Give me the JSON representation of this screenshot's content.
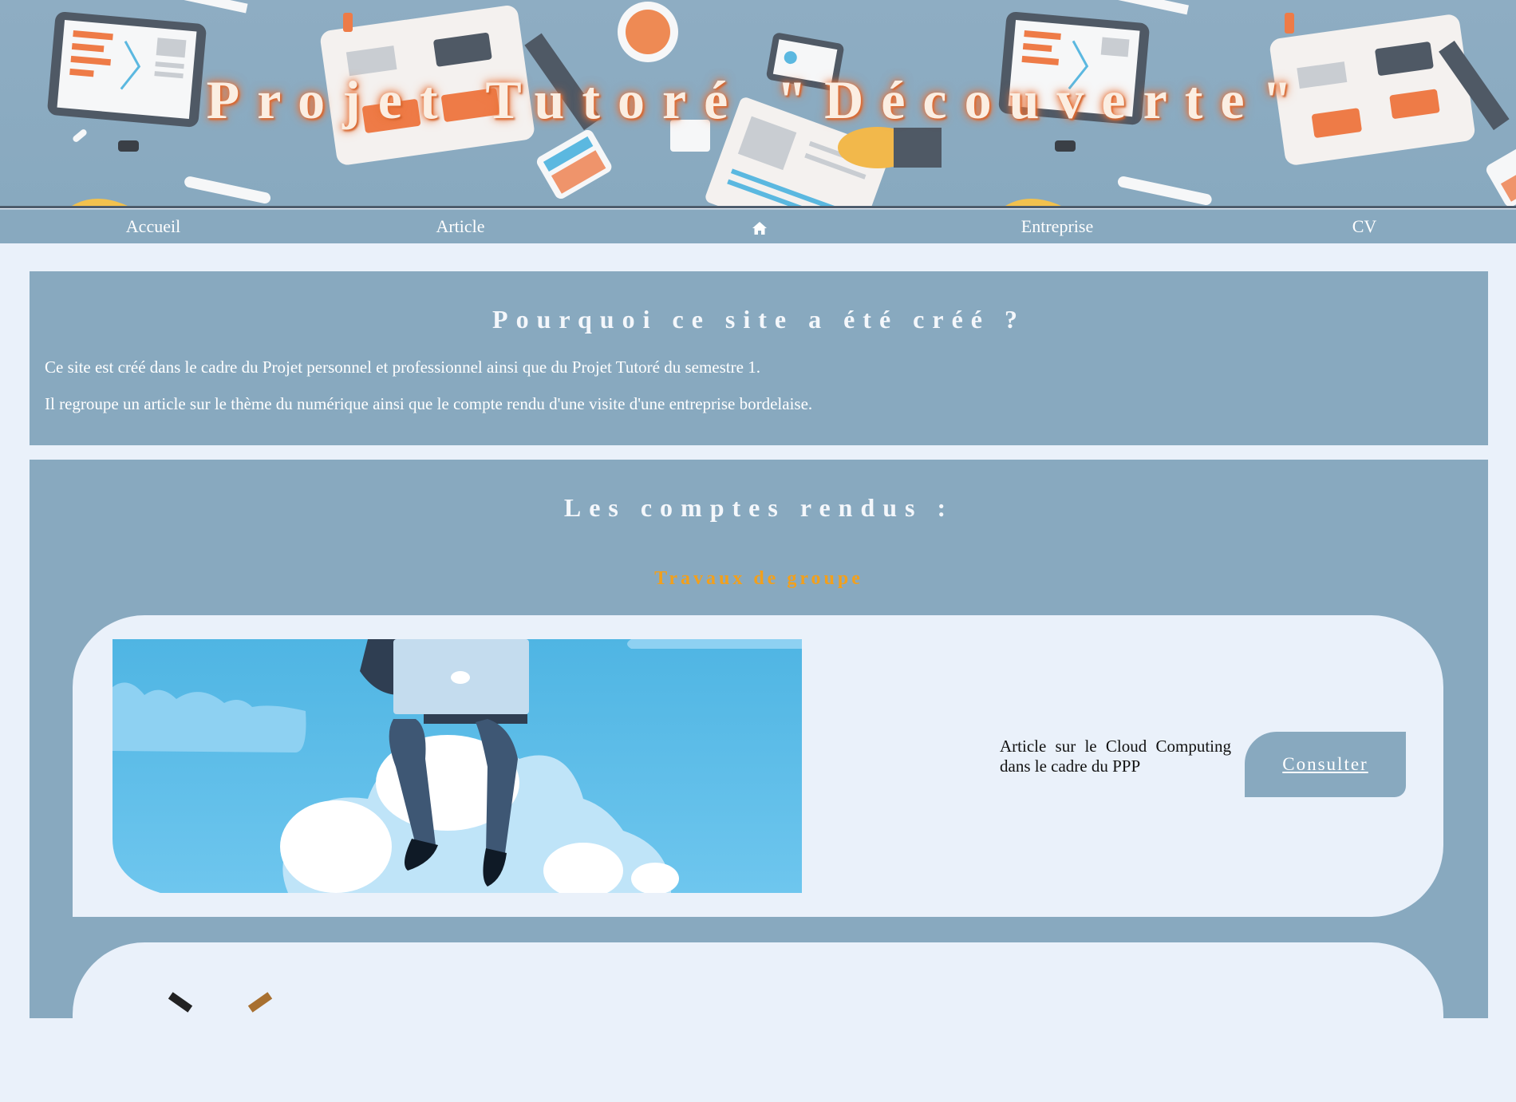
{
  "banner": {
    "title": "Projet Tutoré \"Découverte\""
  },
  "nav": {
    "items": [
      "Accueil",
      "Article",
      "Entreprise",
      "CV"
    ],
    "home_icon": "home-icon"
  },
  "intro": {
    "title": "Pourquoi ce site a été créé ?",
    "paragraphs": [
      "Ce site est créé dans le cadre du Projet personnel et professionnel ainsi que du Projet Tutoré du semestre 1.",
      "Il regroupe un article sur le thème du numérique ainsi que le compte rendu d'une visite d'une entreprise bordelaise."
    ]
  },
  "reports": {
    "title": "Les comptes rendus :",
    "subtitle": "Travaux de groupe",
    "cards": [
      {
        "text": "Article sur le Cloud Computing dans le cadre du PPP",
        "button": "Consulter"
      }
    ]
  },
  "colors": {
    "accent": "#88a9bf",
    "background": "#eaf1fa",
    "subtitle": "#f2a01c",
    "title_glow": "#e8743b"
  }
}
